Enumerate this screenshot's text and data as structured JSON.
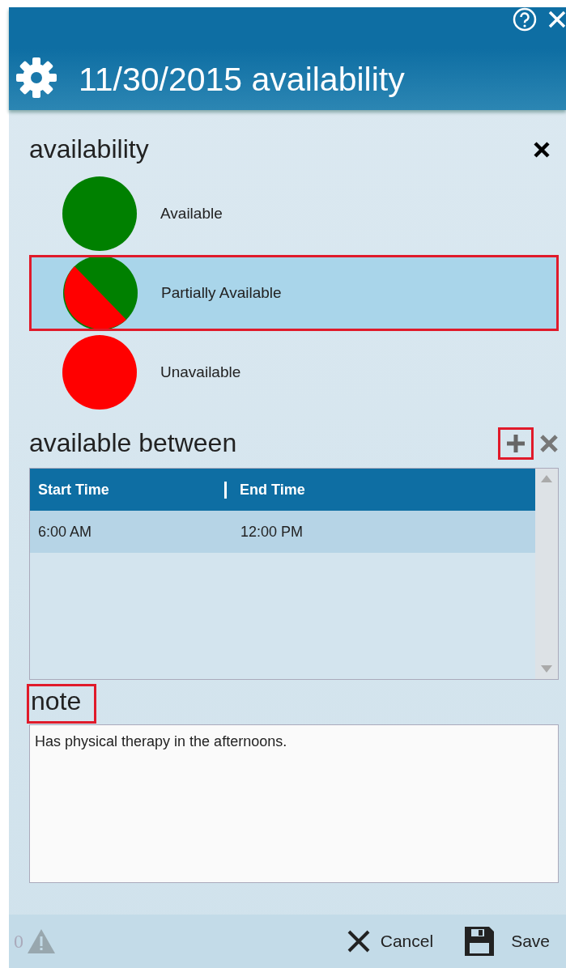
{
  "window": {
    "title": "11/30/2015 availability"
  },
  "availability": {
    "heading": "availability",
    "options": [
      {
        "kind": "available",
        "label": "Available",
        "selected": false
      },
      {
        "kind": "partial",
        "label": "Partially Available",
        "selected": true,
        "annotated": true
      },
      {
        "kind": "unavailable",
        "label": "Unavailable",
        "selected": false
      }
    ]
  },
  "available_between": {
    "heading": "available between",
    "add_annotated": true,
    "table": {
      "columns": [
        "Start Time",
        "End Time"
      ],
      "rows": [
        {
          "cells": [
            "6:00 AM",
            "12:00 PM"
          ],
          "selected": true
        }
      ]
    }
  },
  "note": {
    "heading": "note",
    "annotated": true,
    "value": "Has physical therapy in the afternoons."
  },
  "footer": {
    "warning_count": "0",
    "buttons": [
      "Cancel",
      "Save"
    ]
  }
}
